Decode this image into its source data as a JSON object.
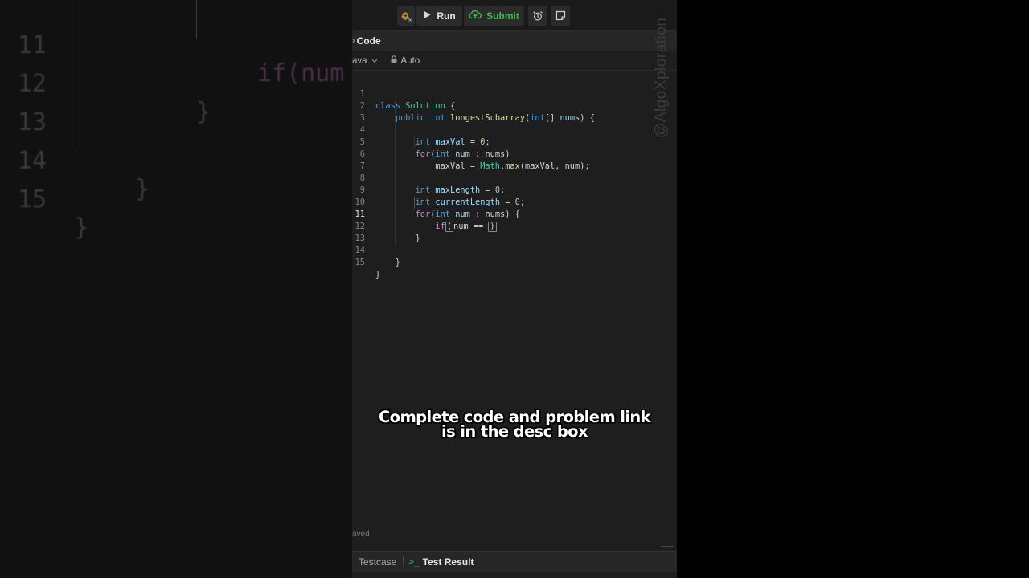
{
  "background": {
    "lines": [
      {
        "num": "11",
        "code": "if(num"
      },
      {
        "num": "12",
        "code": "}"
      },
      {
        "num": "13",
        "code": ""
      },
      {
        "num": "14",
        "code": "}"
      },
      {
        "num": "15",
        "code": "}"
      }
    ]
  },
  "toolbar": {
    "run_label": "Run",
    "submit_label": "Submit",
    "colors": {
      "submit": "#3fb950",
      "debug": "#e8a23a"
    }
  },
  "tab": {
    "label": "Code"
  },
  "langbar": {
    "language": "ava",
    "mode": "Auto"
  },
  "editor": {
    "active_line": "11",
    "line_numbers": [
      "1",
      "2",
      "3",
      "4",
      "5",
      "6",
      "7",
      "8",
      "9",
      "10",
      "11",
      "12",
      "13",
      "14",
      "15"
    ]
  },
  "watermark": "@AlgoXploration",
  "caption": {
    "line1": "Complete code and problem link",
    "line2": "is in the desc box"
  },
  "status": {
    "saved": "aved"
  },
  "bottom": {
    "testcase_label": "Testcase",
    "result_label": "Test Result"
  }
}
